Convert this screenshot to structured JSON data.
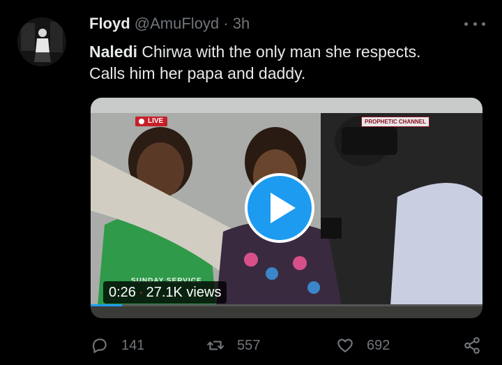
{
  "tweet": {
    "author": {
      "name": "Floyd",
      "handle": "@AmuFloyd",
      "separator": "·",
      "time": "3h"
    },
    "text_bold": "Naledi",
    "text_rest_line1": " Chirwa with the only man she respects.",
    "text_line2": "Calls him her papa and daddy."
  },
  "video": {
    "live_badge": "LIVE",
    "channel_logo": "PROPHETIC CHANNEL",
    "lower_third": "SUNDAY SERVICE",
    "duration": "0:26",
    "views": "27.1K views",
    "progress": 0.08
  },
  "actions": {
    "replies": "141",
    "retweets": "557",
    "likes": "692"
  },
  "colors": {
    "background": "#000000",
    "accent": "#1d9bf0",
    "muted": "#71767b",
    "text": "#e7e9ea"
  },
  "icons": [
    "more-icon",
    "play-icon",
    "reply-icon",
    "retweet-icon",
    "like-icon",
    "share-icon"
  ]
}
